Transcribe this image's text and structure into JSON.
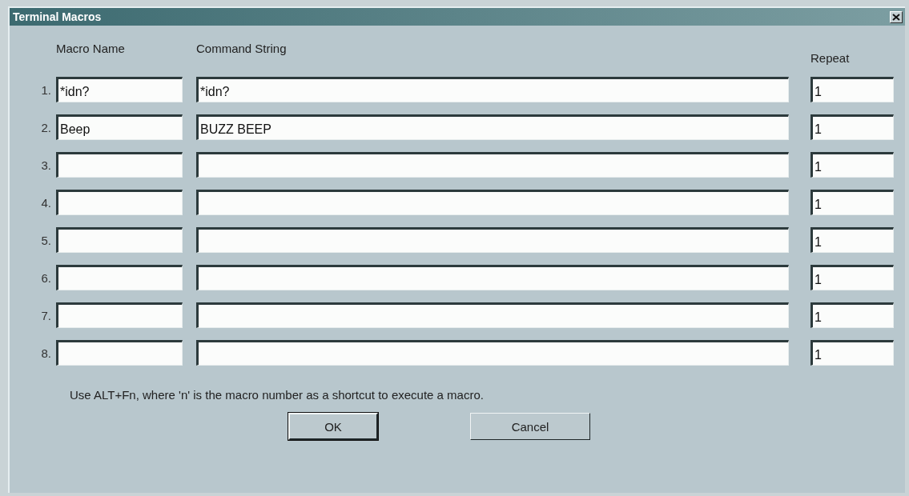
{
  "window": {
    "title": "Terminal Macros"
  },
  "columns": [
    "Macro Name",
    "Command String",
    "Repeat"
  ],
  "rows": [
    {
      "number": "1.",
      "name": "*idn?",
      "command": "*idn?",
      "repeat": "1"
    },
    {
      "number": "2.",
      "name": "Beep",
      "command": "BUZZ BEEP",
      "repeat": "1"
    },
    {
      "number": "3.",
      "repeat": "1"
    },
    {
      "number": "4.",
      "repeat": "1"
    },
    {
      "number": "5.",
      "repeat": "1"
    },
    {
      "number": "6.",
      "repeat": "1"
    },
    {
      "number": "7.",
      "repeat": "1"
    },
    {
      "number": "8.",
      "repeat": "1"
    }
  ],
  "hint": "Use ALT+Fn, where 'n' is the macro number as a shortcut to execute a macro.",
  "buttons": [
    {
      "label": "OK",
      "default": true
    },
    {
      "label": "Cancel",
      "default": false
    }
  ]
}
